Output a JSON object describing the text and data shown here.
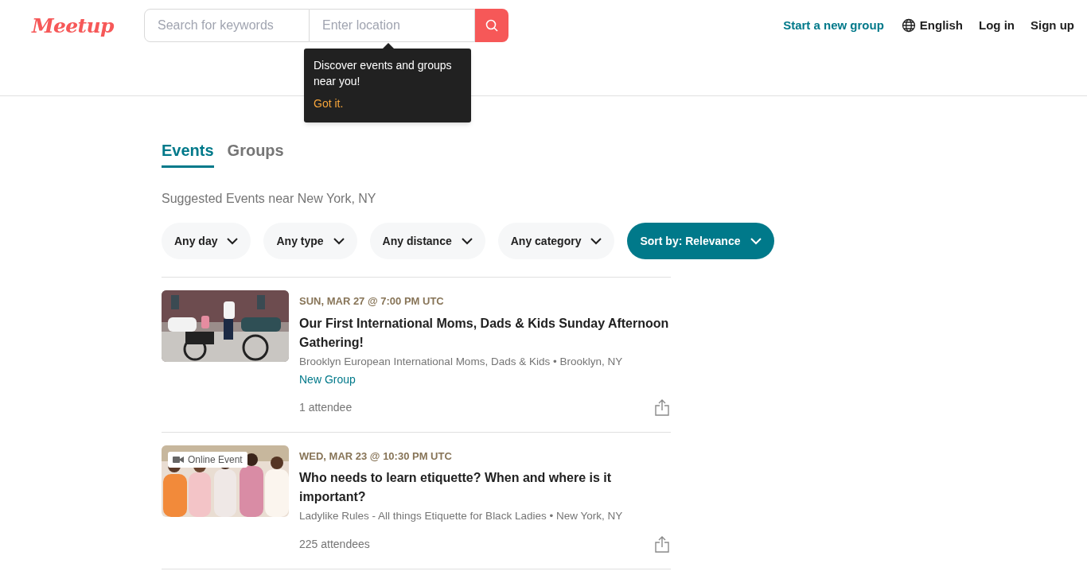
{
  "header": {
    "logo": "Meetup",
    "search": {
      "keywords_placeholder": "Search for keywords",
      "location_placeholder": "Enter location"
    },
    "tooltip": {
      "message": "Discover events and groups near you!",
      "action": "Got it."
    },
    "nav": [
      {
        "label": "Start a new group",
        "kind": "accent"
      },
      {
        "label": "English",
        "kind": "language"
      },
      {
        "label": "Log in",
        "kind": "plain"
      },
      {
        "label": "Sign up",
        "kind": "plain"
      }
    ]
  },
  "tabs": [
    {
      "label": "Events",
      "selected": true
    },
    {
      "label": "Groups",
      "selected": false
    }
  ],
  "subtitle": "Suggested Events near New York, NY",
  "filters": [
    {
      "label": "Any day",
      "selected": false
    },
    {
      "label": "Any type",
      "selected": false
    },
    {
      "label": "Any distance",
      "selected": false
    },
    {
      "label": "Any category",
      "selected": false
    },
    {
      "label": "Sort by: Relevance",
      "selected": true
    }
  ],
  "events": [
    {
      "date": "SUN, MAR 27 @ 7:00 PM UTC",
      "title": "Our First International Moms, Dads & Kids Sunday Afternoon Gathering!",
      "group": "Brooklyn European International Moms, Dads & Kids • Brooklyn, NY",
      "badge": "New Group",
      "attendees": "1 attendee"
    },
    {
      "date": "WED, MAR 23 @ 10:30 PM UTC",
      "title": "Who needs to learn etiquette? When and where is it important?",
      "group": "Ladylike Rules - All things Etiquette for Black Ladies • New York, NY",
      "online_label": "Online Event",
      "attendees": "225 attendees"
    }
  ]
}
